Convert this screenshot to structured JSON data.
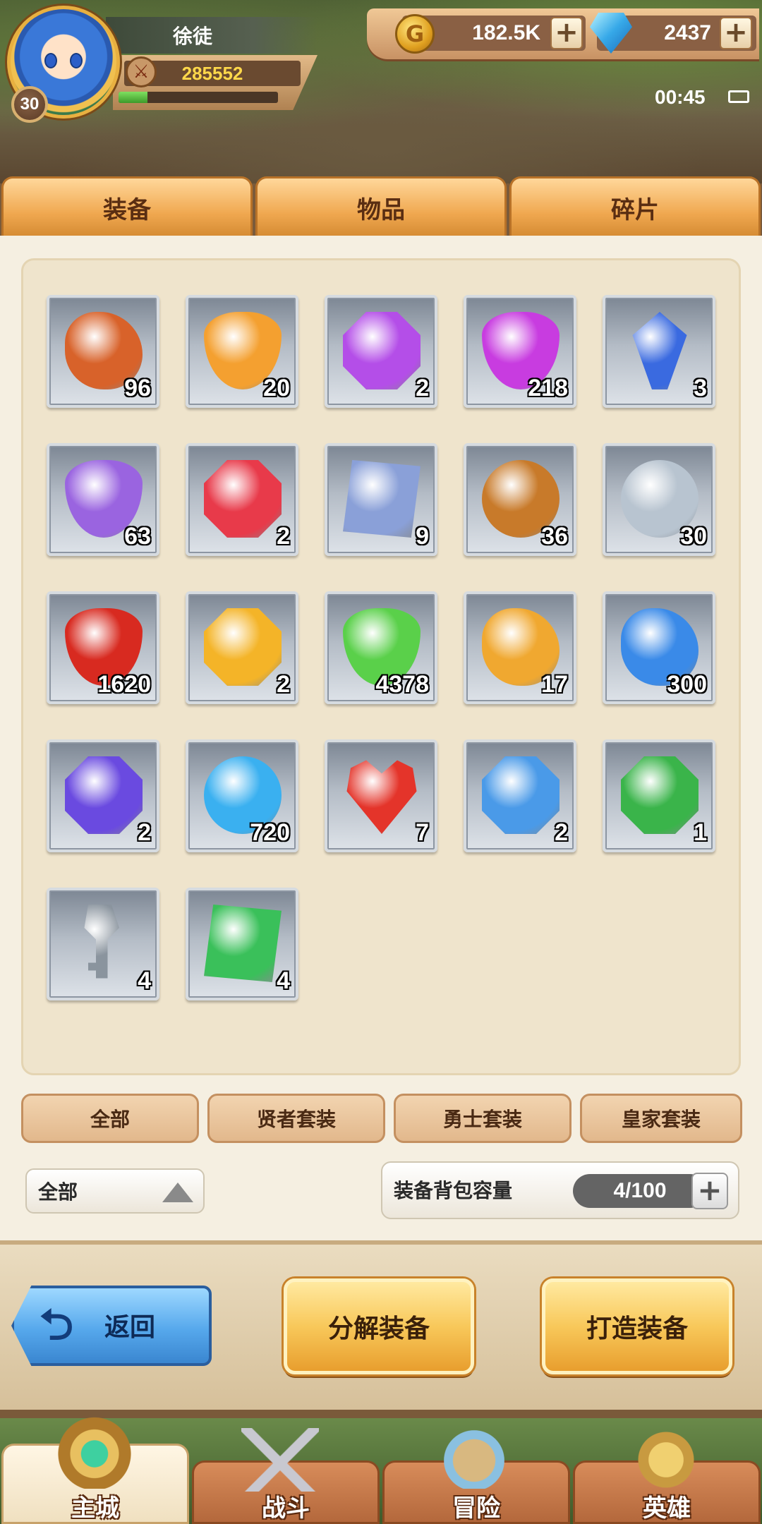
{
  "player": {
    "name": "徐徒",
    "level": "30",
    "power": "285552",
    "exp_fraction": 0.18,
    "avatar_icon": "hero-portrait-icon",
    "power_icon": "crossed-swords-icon"
  },
  "currency": {
    "gold": "182.5K",
    "gems": "2437",
    "gold_icon": "gold-coin-icon",
    "gem_icon": "blue-diamond-icon",
    "plus": "+"
  },
  "status": {
    "time": "00:45"
  },
  "tabs": [
    "装备",
    "物品",
    "碎片"
  ],
  "inventory": [
    {
      "icon": "ore-stone-icon",
      "count": "96",
      "color": "#d8622a",
      "shape": "rock"
    },
    {
      "icon": "orange-potion-icon",
      "count": "20",
      "color": "#f4a030",
      "shape": "bottle"
    },
    {
      "icon": "purple-helmet-gem-icon",
      "count": "2",
      "color": "#b44ee8",
      "shape": "oct"
    },
    {
      "icon": "purple-potion-icon",
      "count": "218",
      "color": "#c83ce0",
      "shape": "bottle"
    },
    {
      "icon": "blue-crystal-icon",
      "count": "3",
      "color": "#3a6ae0",
      "shape": "gem"
    },
    {
      "icon": "purple-crystal-jar-icon",
      "count": "63",
      "color": "#9a64e0",
      "shape": "bottle"
    },
    {
      "icon": "red-sword-gem-icon",
      "count": "2",
      "color": "#e83a4a",
      "shape": "oct"
    },
    {
      "icon": "helmet-scroll-icon",
      "count": "9",
      "color": "#8aa0d8",
      "shape": "scroll"
    },
    {
      "icon": "bronze-coin-icon",
      "count": "36",
      "color": "#c87a2a",
      "shape": "round"
    },
    {
      "icon": "silver-coin-icon",
      "count": "30",
      "color": "#b8c4d0",
      "shape": "round"
    },
    {
      "icon": "red-potion-icon",
      "count": "1620",
      "color": "#d82a20",
      "shape": "bottle"
    },
    {
      "icon": "gold-armor-gem-icon",
      "count": "2",
      "color": "#f4b428",
      "shape": "oct"
    },
    {
      "icon": "green-potion-icon",
      "count": "4378",
      "color": "#5ad04a",
      "shape": "bottle"
    },
    {
      "icon": "lightning-rune-icon",
      "count": "17",
      "color": "#f0a830",
      "shape": "rock"
    },
    {
      "icon": "blue-crystal-cluster-icon",
      "count": "300",
      "color": "#3a8ae8",
      "shape": "rock"
    },
    {
      "icon": "purple-boots-gem-icon",
      "count": "2",
      "color": "#6a4ae0",
      "shape": "oct"
    },
    {
      "icon": "blue-orb-icon",
      "count": "720",
      "color": "#3ab0f0",
      "shape": "round"
    },
    {
      "icon": "red-heart-icon",
      "count": "7",
      "color": "#e4342a",
      "shape": "heart"
    },
    {
      "icon": "blue-ring-gem-icon",
      "count": "2",
      "color": "#4a9ae8",
      "shape": "oct"
    },
    {
      "icon": "green-glove-gem-icon",
      "count": "1",
      "color": "#3ab44a",
      "shape": "oct"
    },
    {
      "icon": "silver-key-icon",
      "count": "4",
      "color": "#8a949e",
      "shape": "key"
    },
    {
      "icon": "green-sword-scroll-icon",
      "count": "4",
      "color": "#3ac05a",
      "shape": "scroll"
    }
  ],
  "filters": [
    "全部",
    "贤者套装",
    "勇士套装",
    "皇家套装"
  ],
  "sort_dropdown": {
    "selected": "全部"
  },
  "capacity": {
    "label": "装备背包容量",
    "value": "4/100",
    "plus": "+"
  },
  "actions": {
    "back": "返回",
    "back_arrow": "⮌",
    "decompose": "分解装备",
    "craft": "打造装备"
  },
  "bottom_nav": [
    {
      "label": "主城",
      "icon": "city-portal-icon",
      "active": true
    },
    {
      "label": "战斗",
      "icon": "crossed-swords-icon",
      "active": false
    },
    {
      "label": "冒险",
      "icon": "adventure-map-icon",
      "active": false
    },
    {
      "label": "英雄",
      "icon": "hero-crest-icon",
      "active": false
    }
  ]
}
